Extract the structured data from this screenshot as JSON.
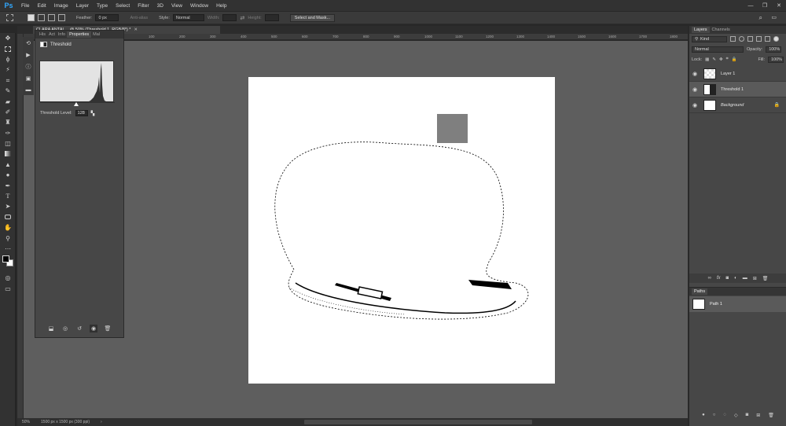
{
  "app": {
    "logo": "Ps"
  },
  "menu": [
    "File",
    "Edit",
    "Image",
    "Layer",
    "Type",
    "Select",
    "Filter",
    "3D",
    "View",
    "Window",
    "Help"
  ],
  "window_controls": [
    "—",
    "❐",
    "✕"
  ],
  "options": {
    "feather_label": "Feather:",
    "feather_value": "0 px",
    "antialias_label": "Anti-alias",
    "style_label": "Style:",
    "style_value": "Normal",
    "width_label": "Width:",
    "height_label": "Height:",
    "select_mask_label": "Select and Mask..."
  },
  "document": {
    "tab_title": "CLARA ANTAL... @ 50% (Threshold 1, RGB/8*) *",
    "zoom": "50%",
    "doc_info": "1500 px x 1500 px (300 ppi)"
  },
  "ruler_ticks": [
    "0",
    "100",
    "200",
    "300",
    "400",
    "500",
    "600",
    "700",
    "800",
    "900",
    "1000",
    "1100",
    "1200",
    "1300",
    "1400",
    "1500",
    "1600",
    "1700",
    "1800",
    "1900",
    "2000",
    "2100"
  ],
  "properties": {
    "tabs": [
      "His",
      "Act",
      "Info",
      "Properties",
      "Mal"
    ],
    "active_tab": "Properties",
    "title": "Threshold",
    "threshold_label": "Threshold Level:",
    "threshold_value": "128"
  },
  "layers": {
    "tabs": [
      "Layers",
      "Channels"
    ],
    "kind_label": "Kind",
    "blend_mode": "Normal",
    "opacity_label": "Opacity:",
    "opacity_value": "100%",
    "lock_label": "Lock:",
    "fill_label": "Fill:",
    "fill_value": "100%",
    "items": [
      {
        "name": "Layer 1",
        "visible": true
      },
      {
        "name": "Threshold 1",
        "visible": true
      },
      {
        "name": "Background",
        "visible": true
      }
    ]
  },
  "paths": {
    "tab": "Paths",
    "items": [
      {
        "name": "Path 1"
      }
    ]
  },
  "colors": {
    "panel_bg": "#474747",
    "canvas_bg": "#5e5e5e",
    "accent": "#31a8ff"
  }
}
